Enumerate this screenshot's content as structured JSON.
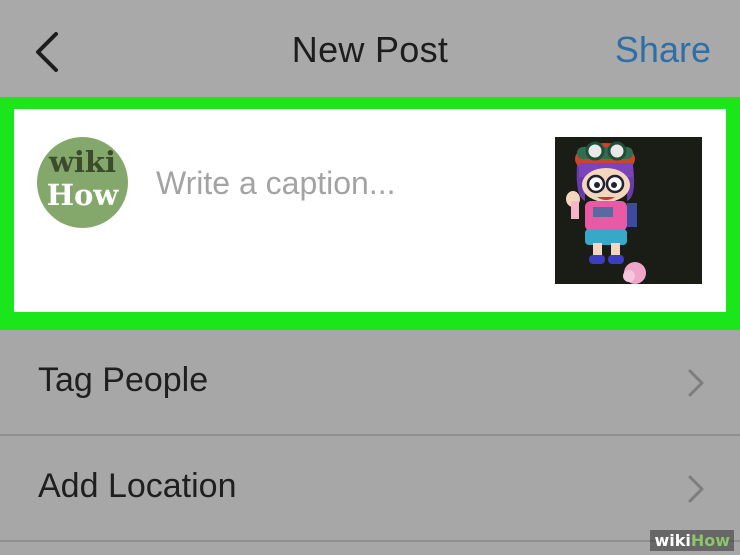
{
  "navbar": {
    "title": "New Post",
    "share_label": "Share"
  },
  "compose": {
    "avatar_top": "wiki",
    "avatar_bottom": "How",
    "caption_placeholder": "Write a caption..."
  },
  "options": [
    {
      "label": "Tag People"
    },
    {
      "label": "Add Location"
    }
  ],
  "watermark": {
    "part1": "wiki",
    "part2": "How"
  },
  "colors": {
    "highlight": "#1be61b",
    "share": "#2e6fa8",
    "background": "#a7a7a7"
  },
  "icons": {
    "back": "chevron-left-icon",
    "row_chevron": "chevron-right-icon"
  }
}
